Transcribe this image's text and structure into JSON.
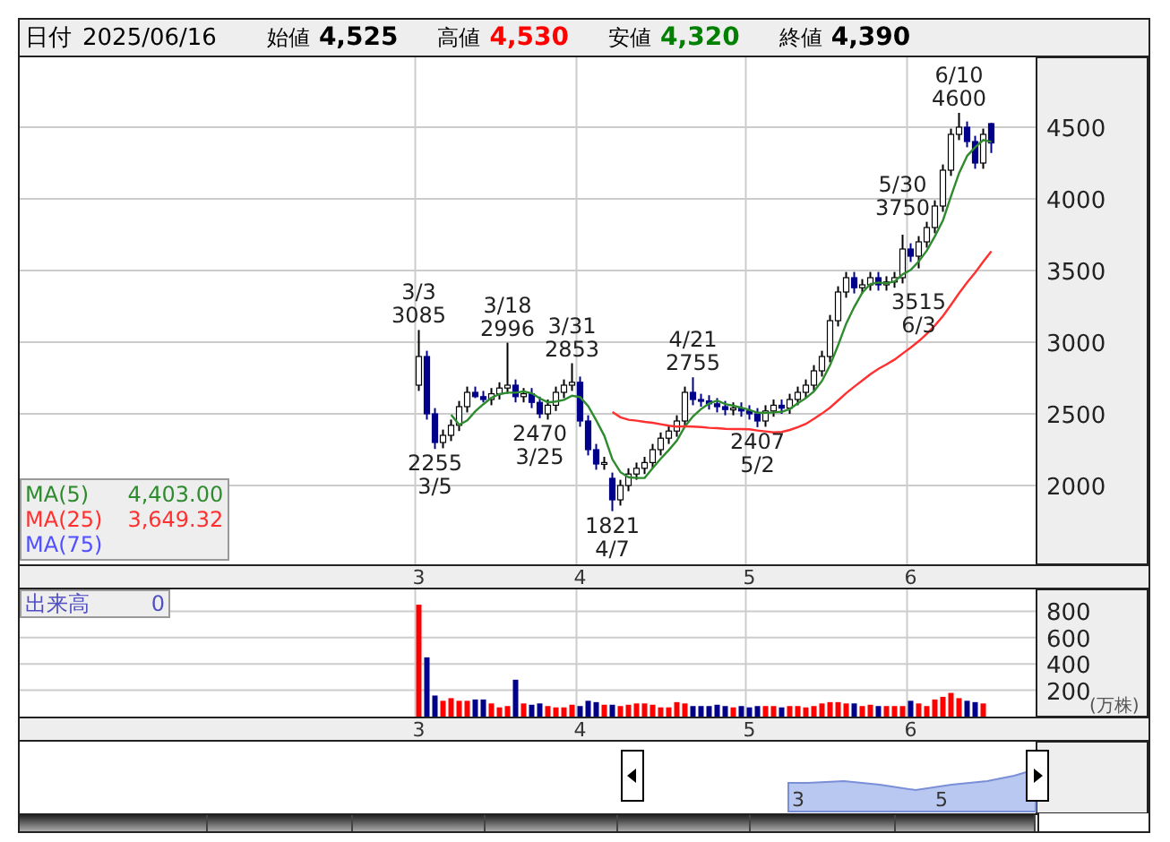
{
  "header": {
    "date_label": "日付",
    "date": "2025/06/16",
    "quotes": [
      {
        "label": "始値",
        "value": "4,525",
        "color": "#000000"
      },
      {
        "label": "高値",
        "value": "4,530",
        "color": "#ff0000"
      },
      {
        "label": "安値",
        "value": "4,320",
        "color": "#008000"
      },
      {
        "label": "終値",
        "value": "4,390",
        "color": "#000000"
      }
    ]
  },
  "price_chart": {
    "legend_values": [
      "4,403.00",
      "3,649.32"
    ],
    "chart_data": {
      "type": "candlestick",
      "grid": true,
      "ylim": [
        1450,
        4987.5
      ],
      "yticks": [
        2000,
        2500,
        3000,
        3500,
        4000,
        4500
      ],
      "categories": [
        null,
        null,
        null,
        null,
        null,
        null,
        null,
        null,
        null,
        null,
        null,
        null,
        null,
        null,
        null,
        null,
        null,
        null,
        null,
        null,
        null,
        null,
        null,
        null,
        null,
        null,
        null,
        null,
        null,
        null,
        null,
        null,
        null,
        null,
        null,
        null,
        null,
        null,
        null,
        null,
        null,
        null,
        null,
        null,
        null,
        null,
        null,
        null,
        null,
        "3",
        null,
        null,
        null,
        null,
        null,
        null,
        null,
        null,
        null,
        null,
        null,
        null,
        null,
        null,
        null,
        null,
        null,
        null,
        null,
        "4",
        null,
        null,
        null,
        null,
        null,
        null,
        null,
        null,
        null,
        null,
        null,
        null,
        null,
        null,
        null,
        null,
        null,
        null,
        null,
        null,
        "5",
        null,
        null,
        null,
        null,
        null,
        null,
        null,
        null,
        null,
        null,
        null,
        null,
        null,
        null,
        null,
        null,
        null,
        null,
        null,
        "6",
        null,
        null,
        null,
        null,
        null,
        null,
        null,
        null,
        null,
        null,
        null,
        null,
        null,
        null,
        null
      ],
      "ohlc": [
        null,
        null,
        null,
        null,
        null,
        null,
        null,
        null,
        null,
        null,
        null,
        null,
        null,
        null,
        null,
        null,
        null,
        null,
        null,
        null,
        null,
        null,
        null,
        null,
        null,
        null,
        null,
        null,
        null,
        null,
        null,
        null,
        null,
        null,
        null,
        null,
        null,
        null,
        null,
        null,
        null,
        null,
        null,
        null,
        null,
        null,
        null,
        null,
        null,
        [
          2700,
          3085,
          2660,
          2900
        ],
        [
          2900,
          2940,
          2460,
          2500
        ],
        [
          2500,
          2540,
          2255,
          2300
        ],
        [
          2300,
          2390,
          2260,
          2350
        ],
        [
          2350,
          2460,
          2310,
          2420
        ],
        [
          2420,
          2590,
          2380,
          2550
        ],
        [
          2550,
          2690,
          2510,
          2650
        ],
        [
          2650,
          2690,
          2610,
          2620
        ],
        [
          2620,
          2660,
          2580,
          2600
        ],
        [
          2600,
          2680,
          2560,
          2640
        ],
        [
          2640,
          2720,
          2600,
          2680
        ],
        [
          2680,
          2996,
          2640,
          2700
        ],
        [
          2700,
          2740,
          2580,
          2620
        ],
        [
          2620,
          2680,
          2580,
          2640
        ],
        [
          2640,
          2680,
          2540,
          2580
        ],
        [
          2580,
          2620,
          2470,
          2500
        ],
        [
          2500,
          2600,
          2460,
          2560
        ],
        [
          2560,
          2690,
          2520,
          2650
        ],
        [
          2650,
          2740,
          2610,
          2700
        ],
        [
          2700,
          2853,
          2660,
          2720
        ],
        [
          2720,
          2760,
          2410,
          2450
        ],
        [
          2450,
          2490,
          2210,
          2250
        ],
        [
          2250,
          2290,
          2110,
          2150
        ],
        [
          2150,
          2200,
          2110,
          2160
        ],
        [
          2050,
          2090,
          1821,
          1900
        ],
        [
          1900,
          2040,
          1860,
          2000
        ],
        [
          2000,
          2120,
          1960,
          2080
        ],
        [
          2080,
          2160,
          2040,
          2120
        ],
        [
          2120,
          2200,
          2080,
          2160
        ],
        [
          2160,
          2290,
          2120,
          2250
        ],
        [
          2250,
          2370,
          2210,
          2330
        ],
        [
          2330,
          2420,
          2290,
          2380
        ],
        [
          2380,
          2490,
          2340,
          2450
        ],
        [
          2450,
          2690,
          2410,
          2650
        ],
        [
          2650,
          2755,
          2560,
          2600
        ],
        [
          2600,
          2640,
          2550,
          2590
        ],
        [
          2590,
          2630,
          2530,
          2570
        ],
        [
          2570,
          2610,
          2510,
          2550
        ],
        [
          2550,
          2590,
          2490,
          2530
        ],
        [
          2530,
          2580,
          2490,
          2540
        ],
        [
          2540,
          2580,
          2480,
          2520
        ],
        [
          2520,
          2560,
          2460,
          2500
        ],
        [
          2500,
          2540,
          2407,
          2450
        ],
        [
          2450,
          2560,
          2410,
          2520
        ],
        [
          2520,
          2600,
          2480,
          2560
        ],
        [
          2560,
          2600,
          2500,
          2540
        ],
        [
          2540,
          2640,
          2500,
          2600
        ],
        [
          2600,
          2690,
          2560,
          2650
        ],
        [
          2650,
          2740,
          2610,
          2700
        ],
        [
          2700,
          2840,
          2660,
          2800
        ],
        [
          2800,
          2940,
          2760,
          2900
        ],
        [
          2900,
          3190,
          2860,
          3150
        ],
        [
          3150,
          3390,
          3110,
          3350
        ],
        [
          3350,
          3490,
          3310,
          3450
        ],
        [
          3450,
          3490,
          3340,
          3380
        ],
        [
          3380,
          3440,
          3340,
          3400
        ],
        [
          3400,
          3490,
          3360,
          3450
        ],
        [
          3450,
          3490,
          3360,
          3400
        ],
        [
          3400,
          3460,
          3360,
          3420
        ],
        [
          3420,
          3490,
          3380,
          3450
        ],
        [
          3450,
          3750,
          3410,
          3650
        ],
        [
          3650,
          3690,
          3560,
          3600
        ],
        [
          3600,
          3740,
          3515,
          3700
        ],
        [
          3700,
          3840,
          3660,
          3800
        ],
        [
          3800,
          3990,
          3760,
          3950
        ],
        [
          3950,
          4240,
          3910,
          4200
        ],
        [
          4200,
          4490,
          4160,
          4450
        ],
        [
          4450,
          4600,
          4410,
          4500
        ],
        [
          4500,
          4540,
          4360,
          4400
        ],
        [
          4400,
          4440,
          4210,
          4250
        ],
        [
          4250,
          4490,
          4210,
          4450
        ],
        [
          4525,
          4530,
          4320,
          4390
        ],
        null,
        null,
        null,
        null,
        null
      ],
      "series": [
        {
          "name": "MA(5)",
          "type": "line",
          "color": "#2e8b2e",
          "values": [
            null,
            null,
            null,
            null,
            null,
            null,
            null,
            null,
            null,
            null,
            null,
            null,
            null,
            null,
            null,
            null,
            null,
            null,
            null,
            null,
            null,
            null,
            null,
            null,
            null,
            null,
            null,
            null,
            null,
            null,
            null,
            null,
            null,
            null,
            null,
            null,
            null,
            null,
            null,
            null,
            null,
            null,
            null,
            null,
            null,
            null,
            null,
            null,
            null,
            null,
            null,
            null,
            null,
            2494,
            2424,
            2454,
            2518,
            2568,
            2612,
            2638,
            2648,
            2648,
            2656,
            2644,
            2608,
            2580,
            2586,
            2598,
            2626,
            2616,
            2554,
            2454,
            2346,
            2182,
            2092,
            2058,
            2052,
            2052,
            2122,
            2188,
            2248,
            2314,
            2412,
            2482,
            2534,
            2572,
            2592,
            2568,
            2556,
            2542,
            2528,
            2508,
            2506,
            2510,
            2514,
            2534,
            2574,
            2610,
            2658,
            2730,
            2840,
            2980,
            3130,
            3246,
            3346,
            3406,
            3416,
            3410,
            3424,
            3474,
            3504,
            3564,
            3640,
            3740,
            3850,
            4020,
            4180,
            4300,
            4360,
            4410,
            4398,
            null,
            null,
            null,
            null,
            null
          ]
        },
        {
          "name": "MA(25)",
          "type": "line",
          "color": "#ff3030",
          "values": [
            null,
            null,
            null,
            null,
            null,
            null,
            null,
            null,
            null,
            null,
            null,
            null,
            null,
            null,
            null,
            null,
            null,
            null,
            null,
            null,
            null,
            null,
            null,
            null,
            null,
            null,
            null,
            null,
            null,
            null,
            null,
            null,
            null,
            null,
            null,
            null,
            null,
            null,
            null,
            null,
            null,
            null,
            null,
            null,
            null,
            null,
            null,
            null,
            null,
            null,
            null,
            null,
            null,
            null,
            null,
            null,
            null,
            null,
            null,
            null,
            null,
            null,
            null,
            null,
            null,
            null,
            null,
            null,
            null,
            null,
            null,
            null,
            null,
            2512,
            2476,
            2459,
            2452,
            2444,
            2437,
            2428,
            2418,
            2411,
            2413,
            2411,
            2408,
            2402,
            2400,
            2395,
            2394,
            2394,
            2392,
            2384,
            2377,
            2370,
            2374,
            2388,
            2408,
            2430,
            2466,
            2502,
            2544,
            2594,
            2645,
            2690,
            2733,
            2776,
            2814,
            2845,
            2879,
            2921,
            2962,
            3008,
            3059,
            3116,
            3183,
            3261,
            3343,
            3418,
            3486,
            3562,
            3634,
            null,
            null,
            null,
            null,
            null
          ]
        },
        {
          "name": "MA(75)",
          "type": "line",
          "color": "#5050ff",
          "values": [
            null,
            null,
            null,
            null,
            null,
            null,
            null,
            null,
            null,
            null,
            null,
            null,
            null,
            null,
            null,
            null,
            null,
            null,
            null,
            null,
            null,
            null,
            null,
            null,
            null,
            null,
            null,
            null,
            null,
            null,
            null,
            null,
            null,
            null,
            null,
            null,
            null,
            null,
            null,
            null,
            null,
            null,
            null,
            null,
            null,
            null,
            null,
            null,
            null,
            null,
            null,
            null,
            null,
            null,
            null,
            null,
            null,
            null,
            null,
            null,
            null,
            null,
            null,
            null,
            null,
            null,
            null,
            null,
            null,
            null,
            null,
            null,
            null,
            null,
            null,
            null,
            null,
            null,
            null,
            null,
            null,
            null,
            null,
            null,
            null,
            null,
            null,
            null,
            null,
            null,
            null,
            null,
            null,
            null,
            null,
            null,
            null,
            null,
            null,
            null,
            null,
            null,
            null,
            null,
            null,
            null,
            null,
            null,
            null,
            null,
            null,
            null,
            null,
            null,
            null,
            null,
            null,
            null,
            null,
            null,
            null,
            null,
            null,
            null,
            null,
            null
          ]
        }
      ],
      "annotations": [
        "3/3\n3085",
        "2255\n3/5",
        "3/18\n2996",
        "2470\n3/25",
        "3/31\n2853",
        "1821\n4/7",
        "4/21\n2755",
        "2407\n5/2",
        "5/30\n3750",
        "3515\n6/3",
        "6/10\n4600"
      ]
    }
  },
  "volume_chart": {
    "label": "出来高",
    "value": "0",
    "unit": "(万株)",
    "chart_data": {
      "type": "bar",
      "grid": true,
      "ylim": [
        0,
        966
      ],
      "yticks": [
        200,
        400,
        600,
        800
      ],
      "categories": [
        null,
        null,
        null,
        null,
        null,
        null,
        null,
        null,
        null,
        null,
        null,
        null,
        null,
        null,
        null,
        null,
        null,
        null,
        null,
        null,
        null,
        null,
        null,
        null,
        null,
        null,
        null,
        null,
        null,
        null,
        null,
        null,
        null,
        null,
        null,
        null,
        null,
        null,
        null,
        null,
        null,
        null,
        null,
        null,
        null,
        null,
        null,
        null,
        null,
        "3",
        null,
        null,
        null,
        null,
        null,
        null,
        null,
        null,
        null,
        null,
        null,
        null,
        null,
        null,
        null,
        null,
        null,
        null,
        null,
        "4",
        null,
        null,
        null,
        null,
        null,
        null,
        null,
        null,
        null,
        null,
        null,
        null,
        null,
        null,
        null,
        null,
        null,
        null,
        null,
        null,
        "5",
        null,
        null,
        null,
        null,
        null,
        null,
        null,
        null,
        null,
        null,
        null,
        null,
        null,
        null,
        null,
        null,
        null,
        null,
        null,
        "6",
        null,
        null,
        null,
        null,
        null,
        null,
        null,
        null,
        null,
        null,
        null,
        null,
        null,
        null,
        null
      ],
      "values": [
        null,
        null,
        null,
        null,
        null,
        null,
        null,
        null,
        null,
        null,
        null,
        null,
        null,
        null,
        null,
        null,
        null,
        null,
        null,
        null,
        null,
        null,
        null,
        null,
        null,
        null,
        null,
        null,
        null,
        null,
        null,
        null,
        null,
        null,
        null,
        null,
        null,
        null,
        null,
        null,
        null,
        null,
        null,
        null,
        null,
        null,
        null,
        null,
        null,
        850,
        450,
        160,
        120,
        140,
        120,
        120,
        130,
        130,
        100,
        70,
        80,
        280,
        100,
        90,
        100,
        80,
        70,
        70,
        90,
        80,
        120,
        110,
        90,
        90,
        80,
        90,
        100,
        100,
        90,
        70,
        70,
        110,
        100,
        80,
        80,
        80,
        90,
        80,
        70,
        80,
        70,
        80,
        80,
        80,
        70,
        80,
        80,
        70,
        80,
        100,
        110,
        110,
        100,
        100,
        80,
        90,
        80,
        80,
        80,
        80,
        120,
        100,
        80,
        130,
        150,
        180,
        140,
        120,
        110,
        100,
        0,
        null,
        null,
        null,
        null,
        null
      ]
    }
  },
  "navigator": {
    "labels": [
      "3",
      "5"
    ]
  }
}
